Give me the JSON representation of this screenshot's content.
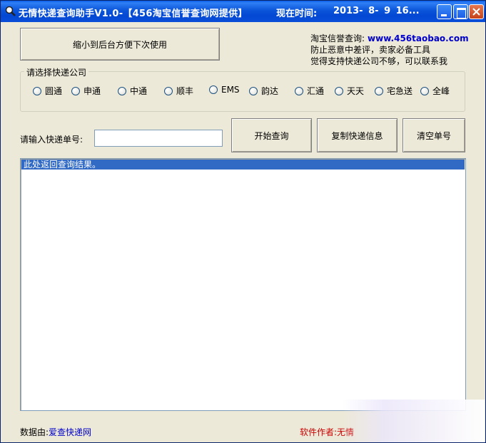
{
  "window": {
    "title": "无情快递查询助手V1.0-【456淘宝信誉查询网提供】",
    "time_label": "现在时间:",
    "time_value": "2013- 8- 9 16..."
  },
  "toolbar": {
    "minimize_label": "缩小到后台方便下次使用"
  },
  "info": {
    "line1_label": "淘宝信誉查询:",
    "line1_link": "www.456taobao.com",
    "line2": "防止恶意中差评，卖家必备工具",
    "line3": "觉得支持快递公司不够，可以联系我"
  },
  "carriers": {
    "legend": "请选择快递公司",
    "options": [
      "圆通",
      "申通",
      "中通",
      "顺丰",
      "EMS",
      "韵达",
      "汇通",
      "天天",
      "宅急送",
      "全峰"
    ]
  },
  "query": {
    "input_label": "请输入快递单号:",
    "input_value": "",
    "start_label": "开始查询",
    "copy_label": "复制快递信息",
    "clear_label": "清空单号"
  },
  "result": {
    "placeholder": "此处返回查询结果。"
  },
  "footer": {
    "source_label": "数据由:",
    "source_link": "爱查快递网",
    "author_label": "软件作者:无情"
  },
  "colors": {
    "title_bar": "#0348d3",
    "selection": "#316ac5",
    "link": "#0000cc",
    "author": "#cc0000"
  }
}
